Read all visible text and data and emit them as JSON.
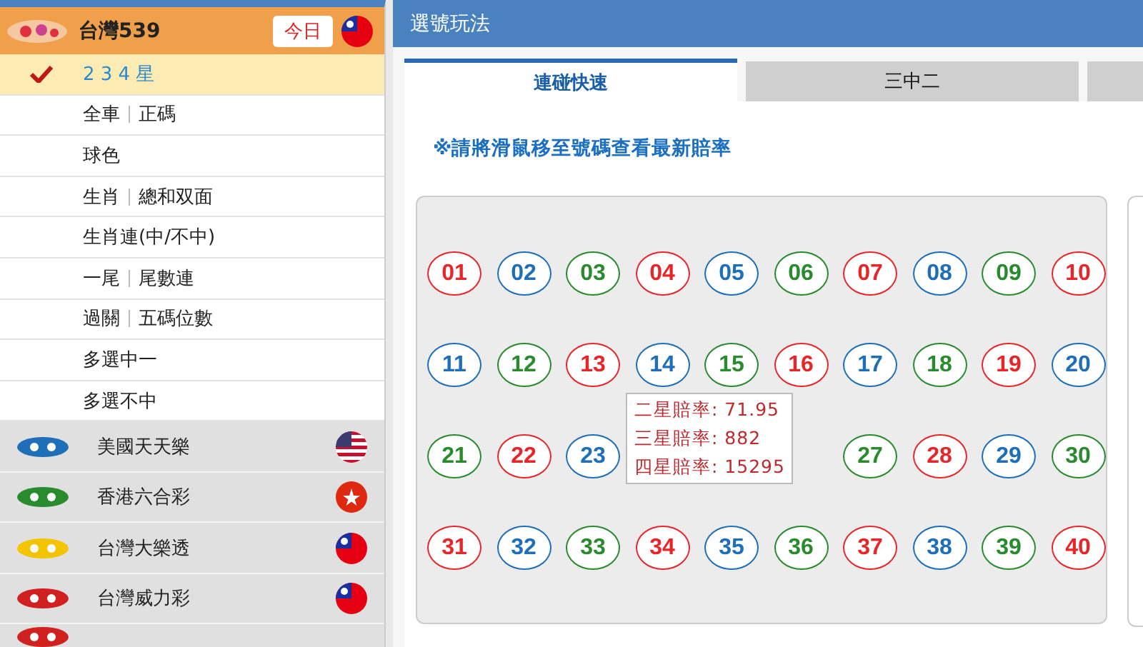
{
  "sidebar": {
    "current_game": {
      "name": "台灣539",
      "badge": "今日",
      "flag": {
        "kind": "tw"
      }
    },
    "play_types": [
      {
        "label": "2 3 4 星",
        "selected": true
      },
      {
        "label": "全車",
        "label_2": "正碼",
        "selected": false
      },
      {
        "label": "球色",
        "selected": false
      },
      {
        "label": "生肖",
        "label_2": "總和双面",
        "selected": false
      },
      {
        "label": "生肖連(中/不中)",
        "selected": false
      },
      {
        "label": "一尾",
        "label_2": "尾數連",
        "selected": false
      },
      {
        "label": "過關",
        "label_2": "五碼位數",
        "selected": false
      },
      {
        "label": "多選中一",
        "selected": false
      },
      {
        "label": "多選不中",
        "selected": false
      }
    ],
    "games": [
      {
        "name": "美國天天樂",
        "flag": {
          "kind": "us"
        }
      },
      {
        "name": "香港六合彩",
        "flag": {
          "kind": "hk"
        }
      },
      {
        "name": "台灣大樂透",
        "flag": {
          "kind": "tw"
        }
      },
      {
        "name": "台灣威力彩",
        "flag": {
          "kind": "tw"
        }
      }
    ]
  },
  "main": {
    "title": "選號玩法",
    "tabs": [
      {
        "label": "連碰快速",
        "selected": true
      },
      {
        "label": "三中二",
        "selected": false
      }
    ],
    "notice": "※請將滑鼠移至號碼查看最新賠率",
    "balls": [
      {
        "kind": "number",
        "number": "01",
        "color": "#e8262a"
      },
      {
        "kind": "number",
        "number": "02",
        "color": "#1e6fb8"
      },
      {
        "kind": "number",
        "number": "03",
        "color": "#2a8a2e"
      },
      {
        "kind": "number",
        "number": "04",
        "color": "#e8262a"
      },
      {
        "kind": "number",
        "number": "05",
        "color": "#1e6fb8"
      },
      {
        "kind": "number",
        "number": "06",
        "color": "#2a8a2e"
      },
      {
        "kind": "number",
        "number": "07",
        "color": "#e8262a"
      },
      {
        "kind": "number",
        "number": "08",
        "color": "#1e6fb8"
      },
      {
        "kind": "number",
        "number": "09",
        "color": "#2a8a2e"
      },
      {
        "kind": "number",
        "number": "10",
        "color": "#e8262a"
      },
      {
        "kind": "number",
        "number": "11",
        "color": "#1e6fb8"
      },
      {
        "kind": "number",
        "number": "12",
        "color": "#2a8a2e"
      },
      {
        "kind": "number",
        "number": "13",
        "color": "#e8262a"
      },
      {
        "kind": "number",
        "number": "14",
        "color": "#1e6fb8"
      },
      {
        "kind": "number",
        "number": "15",
        "color": "#2a8a2e"
      },
      {
        "kind": "number",
        "number": "16",
        "color": "#e8262a"
      },
      {
        "kind": "number",
        "number": "17",
        "color": "#1e6fb8"
      },
      {
        "kind": "number",
        "number": "18",
        "color": "#2a8a2e"
      },
      {
        "kind": "number",
        "number": "19",
        "color": "#e8262a"
      },
      {
        "kind": "number",
        "number": "20",
        "color": "#1e6fb8"
      },
      {
        "kind": "number",
        "number": "21",
        "color": "#2a8a2e"
      },
      {
        "kind": "number",
        "number": "22",
        "color": "#e8262a"
      },
      {
        "kind": "number",
        "number": "23",
        "color": "#1e6fb8"
      },
      {
        "kind": "covered"
      },
      {
        "kind": "covered"
      },
      {
        "kind": "covered"
      },
      {
        "kind": "number",
        "number": "27",
        "color": "#2a8a2e"
      },
      {
        "kind": "number",
        "number": "28",
        "color": "#e8262a"
      },
      {
        "kind": "number",
        "number": "29",
        "color": "#1e6fb8"
      },
      {
        "kind": "number",
        "number": "30",
        "color": "#2a8a2e"
      },
      {
        "kind": "number",
        "number": "31",
        "color": "#e8262a"
      },
      {
        "kind": "number",
        "number": "32",
        "color": "#1e6fb8"
      },
      {
        "kind": "number",
        "number": "33",
        "color": "#2a8a2e"
      },
      {
        "kind": "number",
        "number": "34",
        "color": "#e8262a"
      },
      {
        "kind": "number",
        "number": "35",
        "color": "#1e6fb8"
      },
      {
        "kind": "number",
        "number": "36",
        "color": "#2a8a2e"
      },
      {
        "kind": "number",
        "number": "37",
        "color": "#e8262a"
      },
      {
        "kind": "number",
        "number": "38",
        "color": "#1e6fb8"
      },
      {
        "kind": "number",
        "number": "39",
        "color": "#2a8a2e"
      },
      {
        "kind": "number",
        "number": "40",
        "color": "#e8262a"
      }
    ],
    "tooltip": [
      "二星賠率: 71.95",
      "三星賠率: 882",
      "四星賠率: 15295"
    ]
  }
}
